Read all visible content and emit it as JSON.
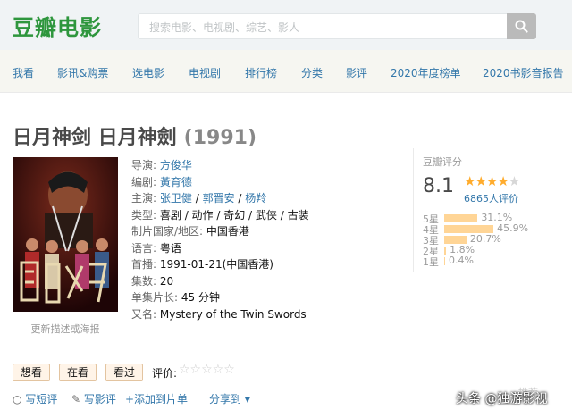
{
  "header": {
    "logo": "豆瓣电影",
    "search_placeholder": "搜索电影、电视剧、综艺、影人"
  },
  "nav": [
    "我看",
    "影讯&购票",
    "选电影",
    "电视剧",
    "排行榜",
    "分类",
    "影评",
    "2020年度榜单",
    "2020书影音报告"
  ],
  "movie": {
    "title": "日月神剑 日月神劍",
    "year": "(1991)",
    "poster_caption": "更新描述或海报",
    "info": {
      "director_label": "导演:",
      "director": "方俊华",
      "writer_label": "编剧:",
      "writer": "黃育德",
      "cast_label": "主演:",
      "cast": [
        "张卫健",
        "郭晋安",
        "杨羚"
      ],
      "genre_label": "类型:",
      "genre": "喜剧 / 动作 / 奇幻 / 武侠 / 古装",
      "country_label": "制片国家/地区:",
      "country": "中国香港",
      "language_label": "语言:",
      "language": "粤语",
      "premiere_label": "首播:",
      "premiere": "1991-01-21(中国香港)",
      "episodes_label": "集数:",
      "episodes": "20",
      "runtime_label": "单集片长:",
      "runtime": "45 分钟",
      "aka_label": "又名:",
      "aka": "Mystery of the Twin Swords"
    }
  },
  "rating": {
    "label": "豆瓣评分",
    "score": "8.1",
    "stars": 4,
    "votes": "6865人评价",
    "breakdown": [
      {
        "label": "5星",
        "pct": "31.1%",
        "value": 31.1
      },
      {
        "label": "4星",
        "pct": "45.9%",
        "value": 45.9
      },
      {
        "label": "3星",
        "pct": "20.7%",
        "value": 20.7
      },
      {
        "label": "2星",
        "pct": "1.8%",
        "value": 1.8
      },
      {
        "label": "1星",
        "pct": "0.4%",
        "value": 0.4
      }
    ],
    "bar_color": "#ffd596",
    "star_color": "#ffac2d"
  },
  "user_actions": {
    "want": "想看",
    "watching": "在看",
    "watched": "看过",
    "rate_label": "评价:",
    "rate_stars": "☆☆☆☆☆"
  },
  "footer_actions": {
    "short_review": "写短评",
    "review": "写影评",
    "add_list": "+添加到片单",
    "share": "分享到 ▾"
  },
  "rec_tag": "推荐",
  "watermark": "头条 @独游影视"
}
